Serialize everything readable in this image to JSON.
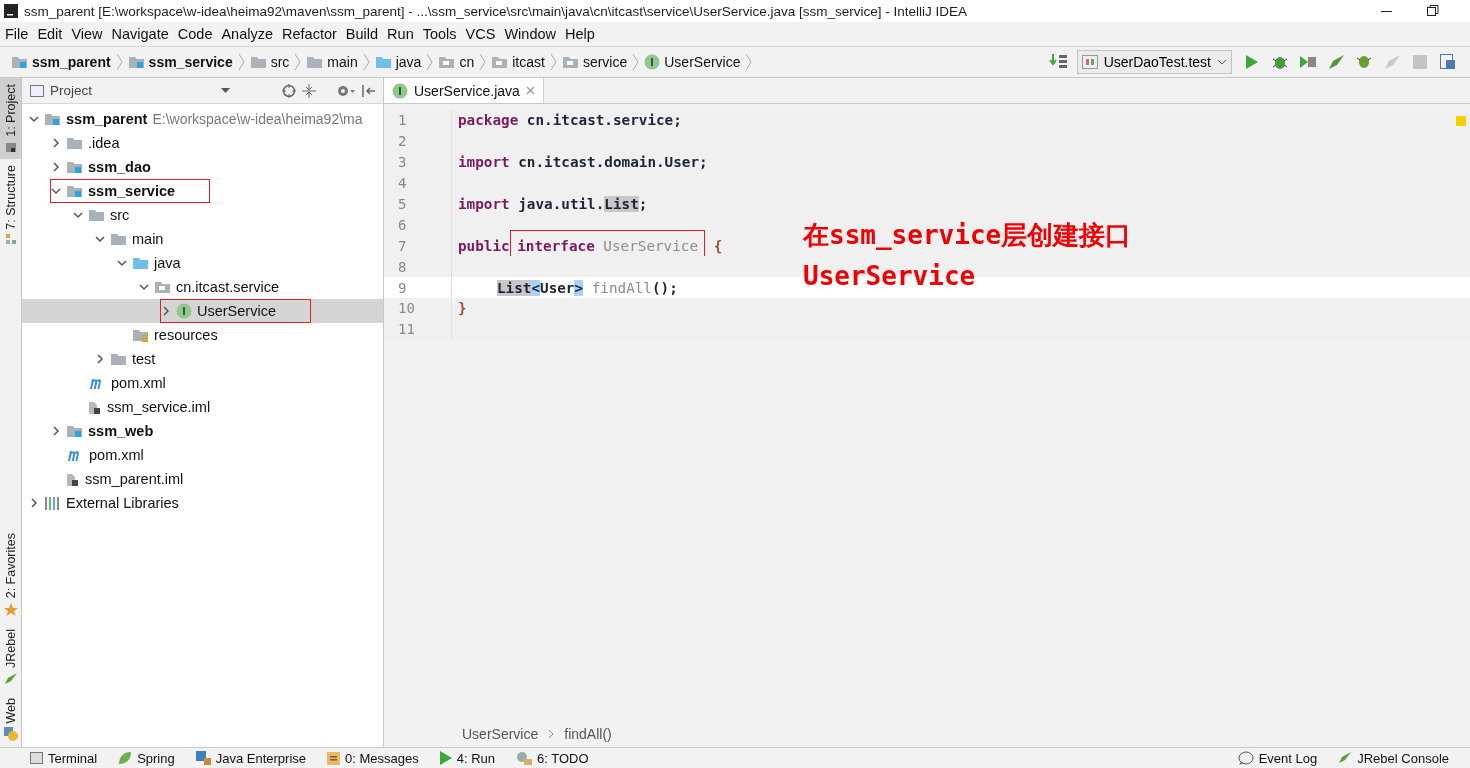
{
  "window": {
    "title": "ssm_parent [E:\\workspace\\w-idea\\heima92\\maven\\ssm_parent] - ...\\ssm_service\\src\\main\\java\\cn\\itcast\\service\\UserService.java [ssm_service] - IntelliJ IDEA"
  },
  "menu": [
    "File",
    "Edit",
    "View",
    "Navigate",
    "Code",
    "Analyze",
    "Refactor",
    "Build",
    "Run",
    "Tools",
    "VCS",
    "Window",
    "Help"
  ],
  "breadcrumbs": [
    {
      "label": "ssm_parent",
      "kind": "module"
    },
    {
      "label": "ssm_service",
      "kind": "module"
    },
    {
      "label": "src",
      "kind": "folder"
    },
    {
      "label": "main",
      "kind": "folder"
    },
    {
      "label": "java",
      "kind": "source"
    },
    {
      "label": "cn",
      "kind": "package"
    },
    {
      "label": "itcast",
      "kind": "package"
    },
    {
      "label": "service",
      "kind": "package"
    },
    {
      "label": "UserService",
      "kind": "interface"
    }
  ],
  "run_config": "UserDaoTest.test",
  "side_tabs_top": [
    {
      "label": "1: Project",
      "kind": "project",
      "selected": true
    },
    {
      "label": "7: Structure",
      "kind": "structure",
      "selected": false
    }
  ],
  "side_tabs_bottom": [
    {
      "label": "2: Favorites",
      "kind": "favorites",
      "selected": false
    },
    {
      "label": "JRebel",
      "kind": "jrebel",
      "selected": false
    },
    {
      "label": "Web",
      "kind": "web",
      "selected": false
    }
  ],
  "project_panel": {
    "title": "Project",
    "tree": [
      {
        "label": "ssm_parent",
        "kind": "module",
        "hint": "E:\\workspace\\w-idea\\heima92\\ma",
        "expanded": true,
        "selected": false,
        "annotated": false,
        "children": [
          {
            "label": ".idea",
            "kind": "folder",
            "expanded": false,
            "selected": false,
            "annotated": false
          },
          {
            "label": "ssm_dao",
            "kind": "module",
            "expanded": false,
            "selected": false,
            "annotated": false
          },
          {
            "label": "ssm_service",
            "kind": "module",
            "expanded": true,
            "selected": false,
            "annotated": true,
            "children": [
              {
                "label": "src",
                "kind": "folder",
                "expanded": true,
                "selected": false,
                "annotated": false,
                "children": [
                  {
                    "label": "main",
                    "kind": "folder",
                    "expanded": true,
                    "selected": false,
                    "annotated": false,
                    "children": [
                      {
                        "label": "java",
                        "kind": "source",
                        "expanded": true,
                        "selected": false,
                        "annotated": false,
                        "children": [
                          {
                            "label": "cn.itcast.service",
                            "kind": "package",
                            "expanded": true,
                            "selected": false,
                            "annotated": false,
                            "children": [
                              {
                                "label": "UserService",
                                "kind": "interface",
                                "expanded": false,
                                "selected": true,
                                "annotated": true
                              }
                            ]
                          }
                        ]
                      },
                      {
                        "label": "resources",
                        "kind": "resources",
                        "selected": false,
                        "annotated": false
                      }
                    ]
                  },
                  {
                    "label": "test",
                    "kind": "folder",
                    "expanded": false,
                    "selected": false,
                    "annotated": false
                  }
                ]
              },
              {
                "label": "pom.xml",
                "kind": "maven",
                "selected": false,
                "annotated": false
              },
              {
                "label": "ssm_service.iml",
                "kind": "iml",
                "selected": false,
                "annotated": false
              }
            ]
          },
          {
            "label": "ssm_web",
            "kind": "module",
            "expanded": false,
            "selected": false,
            "annotated": false
          },
          {
            "label": "pom.xml",
            "kind": "maven",
            "selected": false,
            "annotated": false
          },
          {
            "label": "ssm_parent.iml",
            "kind": "iml",
            "selected": false,
            "annotated": false
          }
        ]
      },
      {
        "label": "External Libraries",
        "kind": "library",
        "expanded": false,
        "selected": false,
        "annotated": false
      }
    ]
  },
  "editor": {
    "tabs": [
      {
        "label": "UserService.java",
        "selected": true
      }
    ],
    "lines": [
      {
        "number": "1",
        "current": false,
        "tokens": [
          {
            "text": "package",
            "kind": "kw"
          },
          {
            "text": " cn.itcast.service;",
            "kind": "id"
          }
        ]
      },
      {
        "number": "2",
        "current": false
      },
      {
        "number": "3",
        "current": false,
        "tokens": [
          {
            "text": "import",
            "kind": "kw"
          },
          {
            "text": " cn.itcast.domain.User;",
            "kind": "id"
          }
        ]
      },
      {
        "number": "4",
        "current": false
      },
      {
        "number": "5",
        "current": false,
        "tokens": [
          {
            "text": "import",
            "kind": "kw"
          },
          {
            "text": " java.util.",
            "kind": "id"
          },
          {
            "text": "List",
            "kind": "usage"
          },
          {
            "text": ";",
            "kind": "id"
          }
        ]
      },
      {
        "number": "6",
        "current": false
      },
      {
        "number": "7",
        "current": false,
        "tokens": [
          {
            "text": "public ",
            "kind": "kw"
          },
          {
            "text": "interface ",
            "kind": "kw",
            "boxed": true
          },
          {
            "text": "UserService",
            "kind": "dim",
            "boxed": true
          },
          {
            "text": " {",
            "kind": "brace"
          }
        ]
      },
      {
        "number": "8",
        "current": false
      },
      {
        "number": "9",
        "current": true,
        "indented": true,
        "tokens": [
          {
            "text": "List",
            "kind": "usage"
          },
          {
            "text": "<",
            "kind": "match"
          },
          {
            "text": "User",
            "kind": "id"
          },
          {
            "text": ">",
            "kind": "match"
          },
          {
            "text": " findAll",
            "kind": "dim"
          },
          {
            "text": "();",
            "kind": "id"
          }
        ]
      },
      {
        "number": "10",
        "current": false,
        "tokens": [
          {
            "text": "}",
            "kind": "brace"
          }
        ]
      },
      {
        "number": "11",
        "current": false
      }
    ],
    "annotation": [
      "在ssm_service层创建接口",
      "UserService"
    ],
    "breadcrumb": [
      "UserService",
      "findAll()"
    ]
  },
  "bottom_tools": [
    {
      "label": "Terminal",
      "kind": "terminal"
    },
    {
      "label": "Spring",
      "kind": "spring"
    },
    {
      "label": "Java Enterprise",
      "kind": "javaee"
    },
    {
      "label": "0: Messages",
      "kind": "messages"
    },
    {
      "label": "4: Run",
      "kind": "run"
    },
    {
      "label": "6: TODO",
      "kind": "todo"
    }
  ],
  "right_tools": [
    {
      "label": "Event Log",
      "kind": "eventlog"
    },
    {
      "label": "JRebel Console",
      "kind": "jrebel"
    }
  ]
}
